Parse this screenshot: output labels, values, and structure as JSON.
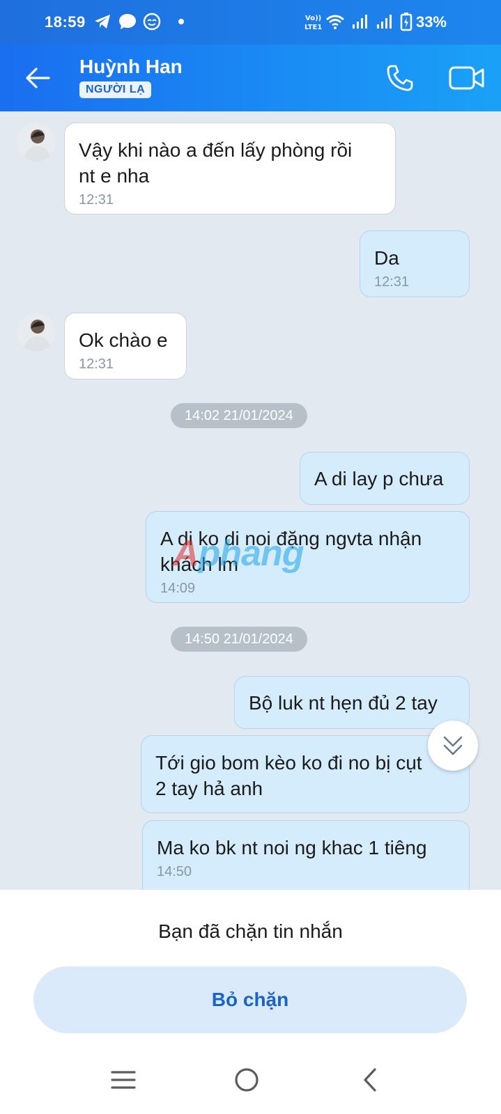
{
  "status_bar": {
    "time": "18:59",
    "battery": "33%",
    "icons": [
      "telegram-icon",
      "messenger-icon",
      "smiley-icon",
      "dot-icon",
      "volte-icon",
      "wifi-icon",
      "signal-icon",
      "signal-icon",
      "battery-charging-icon"
    ]
  },
  "header": {
    "contact_name": "Huỳnh Han",
    "badge": "NGƯỜI LẠ",
    "icons": [
      "back-arrow-icon",
      "phone-icon",
      "video-icon"
    ]
  },
  "messages": [
    {
      "dir": "in",
      "text_line1": "Vậy khi nào a đến lấy phòng rồi",
      "text_line2": "nt e nha",
      "time": "12:31"
    },
    {
      "dir": "out",
      "text": "Da",
      "time": "12:31"
    },
    {
      "dir": "in",
      "text": "Ok chào e",
      "time": "12:31"
    },
    {
      "dir": "out",
      "text": "A di lay p chưa"
    },
    {
      "dir": "out",
      "text_line1": "A di ko di noi đặng ngvta nhận",
      "text_line2": "khách lm",
      "time": "14:09"
    },
    {
      "dir": "out",
      "text": "Bộ luk nt hẹn đủ 2 tay"
    },
    {
      "dir": "out",
      "text_line1": "Tới gio bom kèo ko đi no bị cụt",
      "text_line2": "2 tay hả anh"
    },
    {
      "dir": "out",
      "text": "Ma ko bk nt noi ng khac 1 tiêng",
      "time": "14:50"
    }
  ],
  "date_separators": [
    "14:02 21/01/2024",
    "14:50 21/01/2024"
  ],
  "watermark": {
    "part1": "A",
    "part2": "phang"
  },
  "blocked_panel": {
    "message": "Bạn đã chặn tin nhắn",
    "unblock_label": "Bỏ chặn"
  },
  "colors": {
    "header_start": "#1a6ef0",
    "header_end": "#1aa1f7",
    "chat_bg": "#e2e9f1",
    "outgoing_bubble": "#d5ecfc",
    "accent": "#1a63c9"
  }
}
